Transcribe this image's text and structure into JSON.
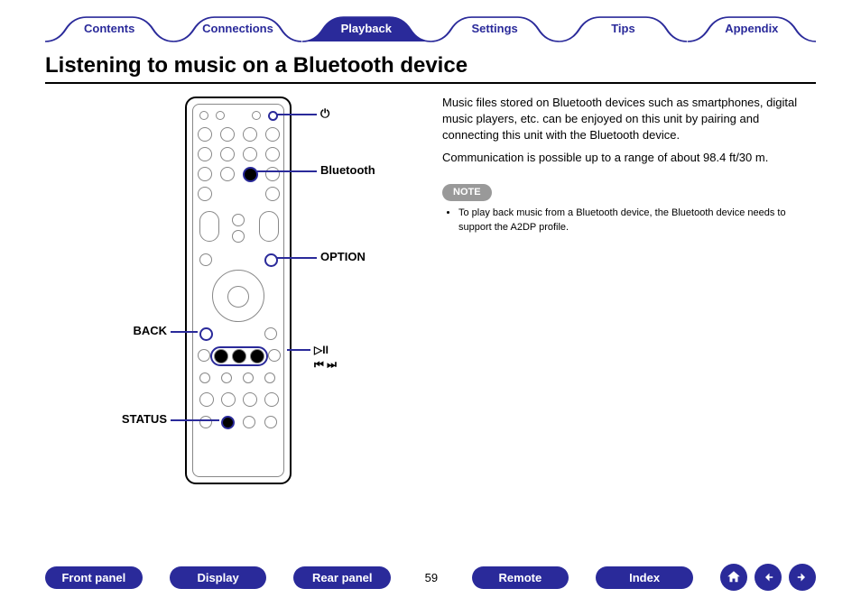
{
  "tabs": {
    "contents": "Contents",
    "connections": "Connections",
    "playback": "Playback",
    "settings": "Settings",
    "tips": "Tips",
    "appendix": "Appendix"
  },
  "heading": "Listening to music on a Bluetooth device",
  "body": {
    "p1": "Music files stored on Bluetooth devices such as smartphones, digital music players, etc. can be enjoyed on this unit by pairing and connecting this unit with the Bluetooth device.",
    "p2": "Communication is possible up to a range of about 98.4 ft/30 m."
  },
  "note": {
    "label": "NOTE",
    "item1": "To play back music from a Bluetooth device, the Bluetooth device needs to support the A2DP profile."
  },
  "callouts": {
    "power": "⏻",
    "bluetooth": "Bluetooth",
    "option": "OPTION",
    "back": "BACK",
    "playpause": "▷II",
    "prevnext": "⏮ ⏭",
    "status": "STATUS"
  },
  "bottom": {
    "front_panel": "Front panel",
    "display": "Display",
    "rear_panel": "Rear panel",
    "page": "59",
    "remote": "Remote",
    "index": "Index"
  }
}
